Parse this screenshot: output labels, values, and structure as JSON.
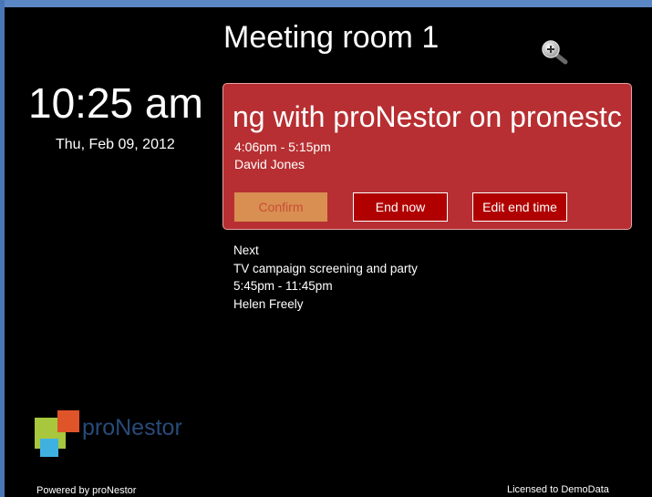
{
  "room": {
    "title": "Meeting room 1"
  },
  "clock": {
    "time": "10:25 am",
    "date": "Thu, Feb 09, 2012"
  },
  "current_meeting": {
    "title": "ng with proNestor on pronestc",
    "time_range": "4:06pm - 5:15pm",
    "organizer": "David Jones",
    "background_color": "#b72f32"
  },
  "actions": {
    "confirm_label": "Confirm",
    "end_now_label": "End now",
    "edit_end_time_label": "Edit end time"
  },
  "next_meeting": {
    "heading": "Next",
    "title": "TV campaign screening and party",
    "time_range": "5:45pm - 11:45pm",
    "organizer": "Helen Freely"
  },
  "logo": {
    "text": "proNestor"
  },
  "footer": {
    "powered_by": "Powered by proNestor",
    "license": "Licensed to DemoData"
  },
  "icons": {
    "zoom": "zoom-in-icon"
  }
}
